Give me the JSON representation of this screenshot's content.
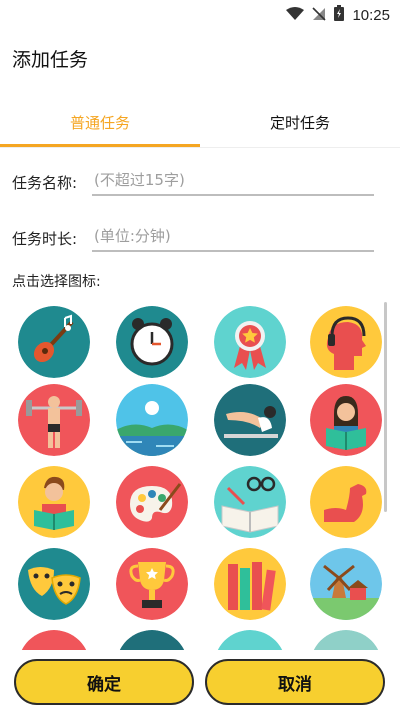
{
  "status": {
    "time": "10:25"
  },
  "title": "添加任务",
  "tabs": {
    "normal": "普通任务",
    "timed": "定时任务"
  },
  "form": {
    "name_label": "任务名称:",
    "name_placeholder": "(不超过15字)",
    "duration_label": "任务时长:",
    "duration_placeholder": "(单位:分钟)"
  },
  "icons_label": "点击选择图标:",
  "icon_names": [
    "guitar-icon",
    "alarm-clock-icon",
    "award-ribbon-icon",
    "headphones-head-icon",
    "weightlifting-icon",
    "lake-landscape-icon",
    "yoga-stretch-icon",
    "woman-reading-icon",
    "man-reading-icon",
    "paint-palette-icon",
    "open-book-glasses-icon",
    "flexed-arm-icon",
    "theater-masks-icon",
    "trophy-icon",
    "books-icon",
    "windmill-village-icon"
  ],
  "buttons": {
    "confirm": "确定",
    "cancel": "取消"
  },
  "colors": {
    "accent": "#f5a623",
    "button_fill": "#f7cf2f",
    "teal": "#1f8a8f",
    "red": "#f0555a",
    "yellow": "#ffc93c"
  }
}
